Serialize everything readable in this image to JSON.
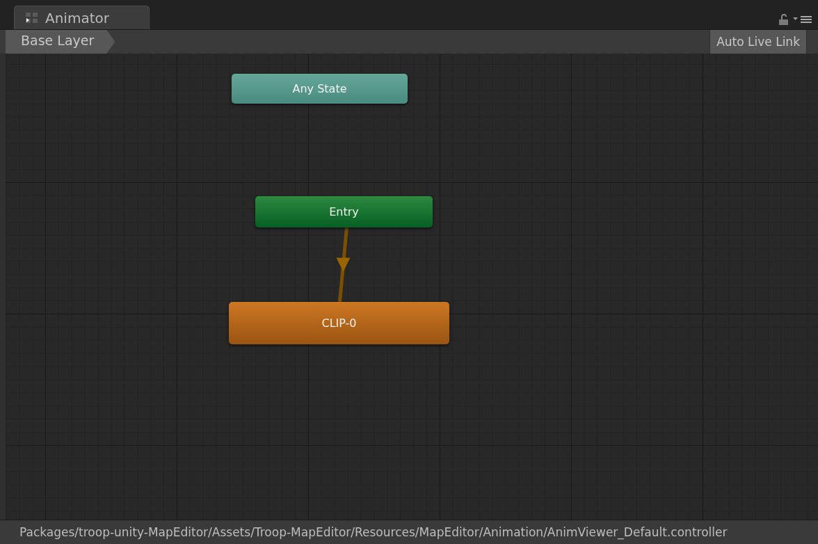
{
  "window": {
    "tab": "Animator"
  },
  "toolbar": {
    "breadcrumb": "Base Layer",
    "auto_live_link": "Auto Live Link"
  },
  "graph": {
    "nodes": [
      {
        "label": "Any State",
        "kind": "any_state",
        "transition_to_next": false
      },
      {
        "label": "Entry",
        "kind": "entry",
        "transition_to_next": true
      },
      {
        "label": "CLIP-0",
        "kind": "state",
        "transition_to_next": false
      }
    ]
  },
  "status_bar": "Packages/troop-unity-MapEditor/Assets/Troop-MapEditor/Resources/MapEditor/Animation/AnimViewer_Default.controller"
}
